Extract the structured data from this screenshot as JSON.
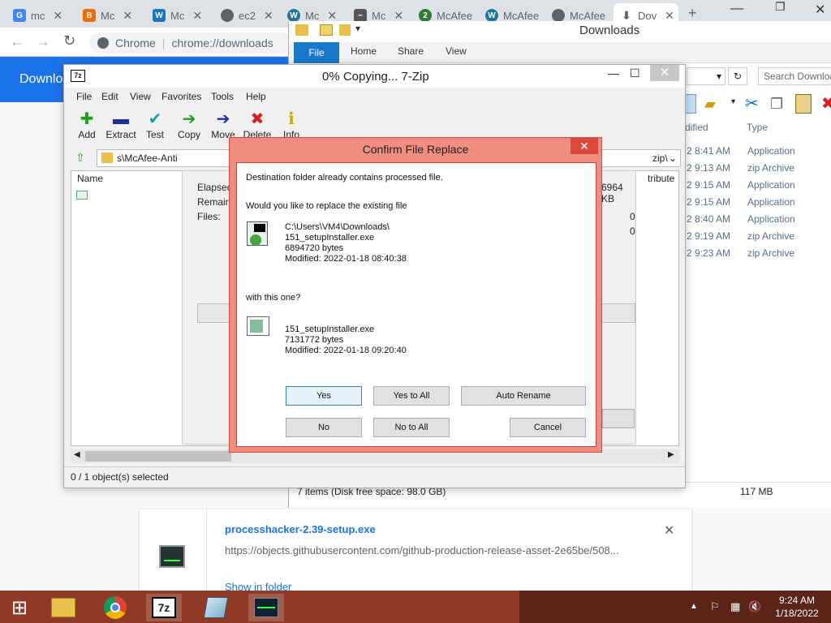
{
  "chrome": {
    "tabs": [
      {
        "label": "mc",
        "icon": "google-icon",
        "color": "#4285f4"
      },
      {
        "label": "Mc",
        "icon": "blogger-icon",
        "color": "#ef6c00"
      },
      {
        "label": "Mc",
        "icon": "mcafee-site-icon",
        "color": "#1b75bc"
      },
      {
        "label": "ec2",
        "icon": "globe-icon",
        "color": "#5f6368"
      },
      {
        "label": "Mc",
        "icon": "wordpress-icon",
        "color": "#21759b"
      },
      {
        "label": "Mc",
        "icon": "chart-site-icon",
        "color": "#555555"
      },
      {
        "label": "McAfee",
        "icon": "badge-2-icon",
        "color": "#2e7d32"
      },
      {
        "label": "McAfee",
        "icon": "wordpress-icon",
        "color": "#21759b"
      },
      {
        "label": "McAfee",
        "icon": "globe-icon",
        "color": "#5f6368"
      },
      {
        "label": "Dov",
        "icon": "download-icon",
        "color": "#5f6368"
      }
    ],
    "new_tab": "+",
    "omnibox_site": "Chrome",
    "omnibox_url": "chrome://downloads",
    "downloads_title": "Downlo"
  },
  "explorer": {
    "title": "Downloads",
    "ribbon_tabs": [
      "File",
      "Home",
      "Share",
      "View"
    ],
    "search_placeholder": "Search Downloa",
    "col_modified": "dified",
    "col_type": "Type",
    "rows": [
      {
        "time": "2 8:41 AM",
        "type": "Application"
      },
      {
        "time": "2 9:13 AM",
        "type": "zip Archive"
      },
      {
        "time": "2 9:15 AM",
        "type": "Application"
      },
      {
        "time": "2 9:15 AM",
        "type": "Application"
      },
      {
        "time": "2 8:40 AM",
        "type": "Application"
      },
      {
        "time": "2 9:19 AM",
        "type": "zip Archive"
      },
      {
        "time": "2 9:23 AM",
        "type": "zip Archive"
      }
    ],
    "status_items": "7 items (Disk free space: 98.0 GB)",
    "status_size": "117 MB"
  },
  "zip": {
    "title": "0% Copying... 7-Zip",
    "menu": [
      "File",
      "Edit",
      "View",
      "Favorites",
      "Tools",
      "Help"
    ],
    "toolbar": [
      {
        "label": "Add",
        "icon": "add-icon",
        "glyph": "✚",
        "color": "#1e9e1e"
      },
      {
        "label": "Extract",
        "icon": "extract-icon",
        "glyph": "▬",
        "color": "#1a2fa0"
      },
      {
        "label": "Test",
        "icon": "test-icon",
        "glyph": "✔",
        "color": "#1fa0a0"
      },
      {
        "label": "Copy",
        "icon": "copy-icon",
        "glyph": "➔",
        "color": "#1e9e1e"
      },
      {
        "label": "Move",
        "icon": "move-icon",
        "glyph": "➔",
        "color": "#1a2fa0"
      },
      {
        "label": "Delete",
        "icon": "delete-icon",
        "glyph": "✖",
        "color": "#d42020"
      },
      {
        "label": "Info",
        "icon": "info-icon",
        "glyph": "ℹ",
        "color": "#c9a800"
      }
    ],
    "path": "s\\McAfee-Anti",
    "path_tail": "zip\\",
    "col_name": "Name",
    "col_attrib": "tribute",
    "progress": {
      "elapsed_label": "Elapsed",
      "remaining_label": "Remainin",
      "files_label": "Files:",
      "size_value": "6964 KB",
      "files_value_1": "0",
      "files_value_2": "0"
    },
    "status": "0 / 1 object(s) selected"
  },
  "dialog": {
    "title": "Confirm File Replace",
    "line1": "Destination folder already contains processed file.",
    "line2": "Would you like to replace the existing file",
    "existing_path": "C:\\Users\\VM4\\Downloads\\",
    "existing_name": "151_setupInstaller.exe",
    "existing_size": "6894720 bytes",
    "existing_modified": "Modified: 2022-01-18 08:40:38",
    "with_this": "with this one?",
    "new_name": "151_setupInstaller.exe",
    "new_size": "7131772 bytes",
    "new_modified": "Modified: 2022-01-18 09:20:40",
    "buttons": {
      "yes": "Yes",
      "yes_all": "Yes to All",
      "auto_rename": "Auto Rename",
      "no": "No",
      "no_all": "No to All",
      "cancel": "Cancel"
    },
    "close": "✕"
  },
  "download_item": {
    "filename": "processhacker-2.39-setup.exe",
    "url": "https://objects.githubusercontent.com/github-production-release-asset-2e65be/508...",
    "show_in_folder": "Show in folder"
  },
  "taskbar": {
    "time": "9:24 AM",
    "date": "1/18/2022"
  }
}
